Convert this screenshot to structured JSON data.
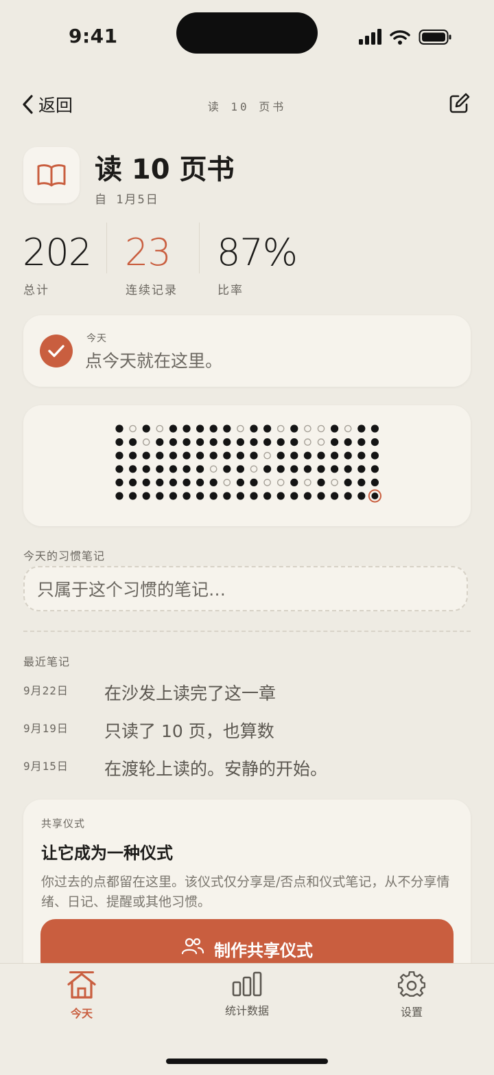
{
  "status_bar": {
    "time": "9:41"
  },
  "nav": {
    "back_label": "返回",
    "title": "读 10 页书"
  },
  "habit": {
    "title": "读 10 页书",
    "since": "自 1月5日",
    "icon": "book-icon"
  },
  "stats": [
    {
      "value": "202",
      "label": "总计",
      "color": "#1c1b19"
    },
    {
      "value": "23",
      "label": "连续记录",
      "color": "#c95e3f"
    },
    {
      "value": "87%",
      "label": "比率",
      "color": "#1c1b19"
    }
  ],
  "today_card": {
    "label": "今天",
    "text": "点今天就在这里。"
  },
  "dot_grid": {
    "legend": "X = completed, o = missed, T = today",
    "rows": [
      "XoXoXXXXXoXXoXooXoXX",
      "XXoXXXXXXXXXXXooXXXX",
      "XXXXXXXXXXXoXXXXXXXX",
      "XXXXXXXoXXoXXXXXXXXX",
      "XXXXXXXXoXXooXoXoXXX",
      "XXXXXXXXXXXXXXXXXXXT"
    ]
  },
  "note": {
    "label": "今天的习惯笔记",
    "placeholder": "只属于这个习惯的笔记…"
  },
  "recent": {
    "label": "最近笔记",
    "items": [
      {
        "date": "9月22日",
        "text": "在沙发上读完了这一章"
      },
      {
        "date": "9月19日",
        "text": "只读了 10 页，也算数"
      },
      {
        "date": "9月15日",
        "text": "在渡轮上读的。安静的开始。"
      }
    ]
  },
  "share": {
    "label": "共享仪式",
    "title": "让它成为一种仪式",
    "description": "你过去的点都留在这里。该仪式仅分享是/否点和仪式笔记，从不分享情绪、日记、提醒或其他习惯。",
    "button_label": "制作共享仪式"
  },
  "tabs": [
    {
      "label": "今天",
      "icon": "home-icon",
      "active": true
    },
    {
      "label": "统计数据",
      "icon": "bar-chart-icon",
      "active": false
    },
    {
      "label": "设置",
      "icon": "gear-icon",
      "active": false
    }
  ],
  "colors": {
    "accent": "#c95e3f",
    "background": "#eeebe3",
    "card": "#f6f3ec"
  }
}
